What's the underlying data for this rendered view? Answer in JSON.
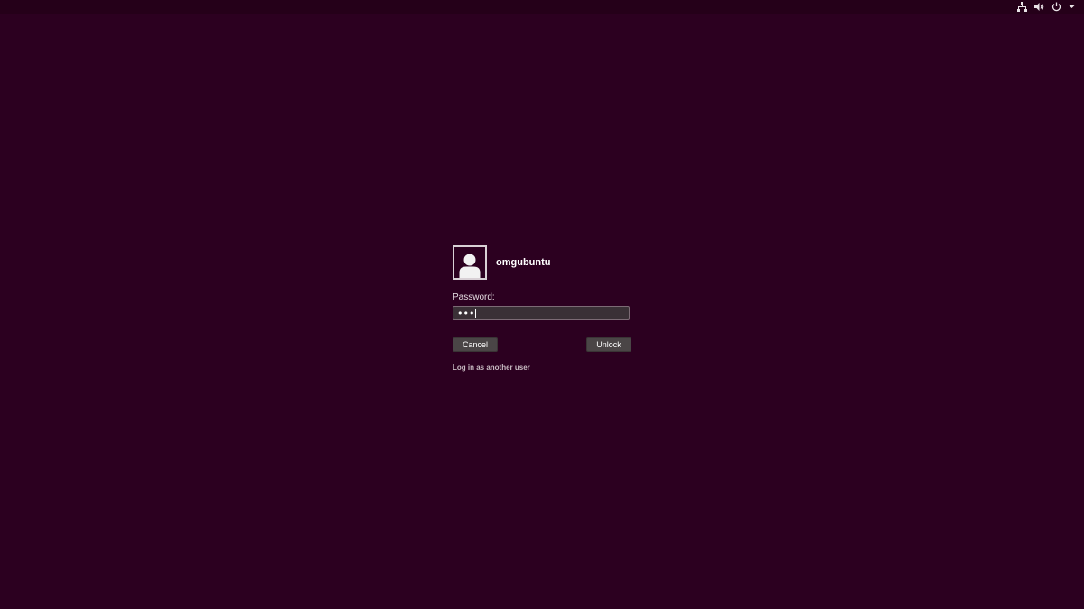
{
  "panel": {
    "indicators": [
      "network-icon",
      "volume-icon",
      "power-icon",
      "chevron-down-icon"
    ]
  },
  "login": {
    "username": "omgubuntu",
    "password_label": "Password:",
    "password_value": "•••",
    "cancel_label": "Cancel",
    "unlock_label": "Unlock",
    "switch_user_label": "Log in as another user"
  },
  "colors": {
    "background": "#2c0020",
    "panel": "#250019",
    "field": "#3a3036",
    "button": "#4a4546"
  }
}
